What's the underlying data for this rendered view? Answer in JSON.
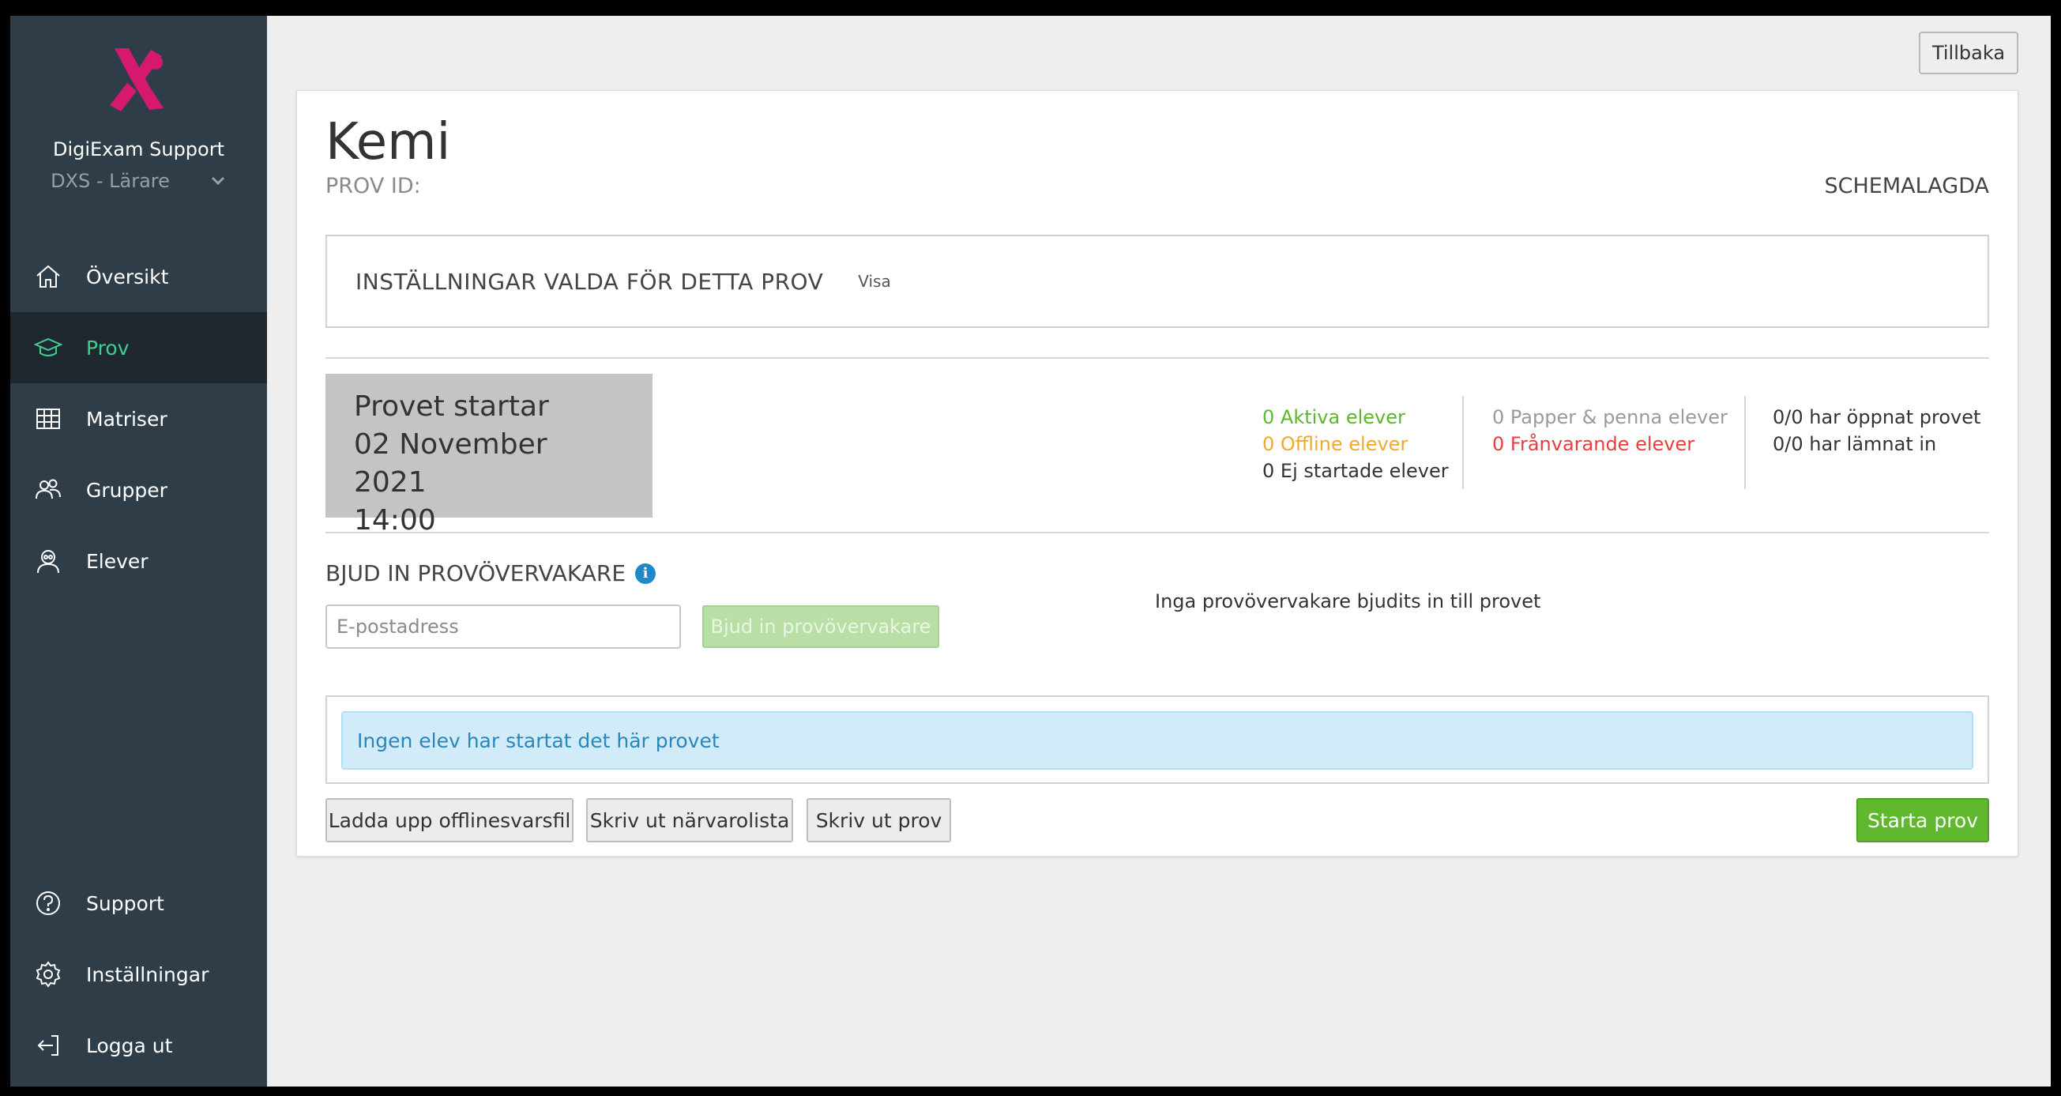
{
  "sidebar": {
    "logo_icon": "digiexam-x-logo",
    "org_name": "DigiExam Support",
    "role": "DXS - Lärare",
    "nav_items": [
      {
        "label": "Översikt",
        "icon": "home-icon"
      },
      {
        "label": "Prov",
        "icon": "graduation-cap-icon"
      },
      {
        "label": "Matriser",
        "icon": "grid-icon"
      },
      {
        "label": "Grupper",
        "icon": "group-icon"
      },
      {
        "label": "Elever",
        "icon": "student-icon"
      }
    ],
    "bottom_items": [
      {
        "label": "Support",
        "icon": "question-icon"
      },
      {
        "label": "Inställningar",
        "icon": "gear-icon"
      },
      {
        "label": "Logga ut",
        "icon": "logout-icon"
      }
    ]
  },
  "header": {
    "back_label": "Tillbaka"
  },
  "exam": {
    "title": "Kemi",
    "prov_id_label": "PROV ID:",
    "status": "SCHEMALAGDA",
    "settings_title": "INSTÄLLNINGAR VALDA FÖR DETTA PROV",
    "settings_link": "Visa",
    "start_line1": "Provet startar",
    "start_line2": "02 November 2021",
    "start_line3": "14:00"
  },
  "stats": {
    "active": "0 Aktiva elever",
    "offline": "0 Offline elever",
    "not_started": "0 Ej startade elever",
    "paper": "0 Papper & penna elever",
    "absent": "0 Frånvarande elever",
    "opened": "0/0 har öppnat provet",
    "submitted": "0/0 har lämnat in"
  },
  "invite": {
    "title": "BJUD IN PROVÖVERVAKARE",
    "info_icon": "info-icon",
    "email_placeholder": "E-postadress",
    "email_value": "",
    "button": "Bjud in provövervakare",
    "empty_text": "Inga provövervakare bjudits in till provet"
  },
  "alert": {
    "text": "Ingen elev har startat det här provet"
  },
  "actions": {
    "upload_offline": "Ladda upp offlinesvarsfil",
    "print_attendance": "Skriv ut närvarolista",
    "print_exam": "Skriv ut prov",
    "start_exam": "Starta prov"
  },
  "colors": {
    "sidebar_bg": "#2f3d48",
    "active_nav": "#3fcf8e",
    "start_button": "#5fb82d",
    "alert_bg": "#d2ebf8",
    "logo": "#d6186f"
  }
}
